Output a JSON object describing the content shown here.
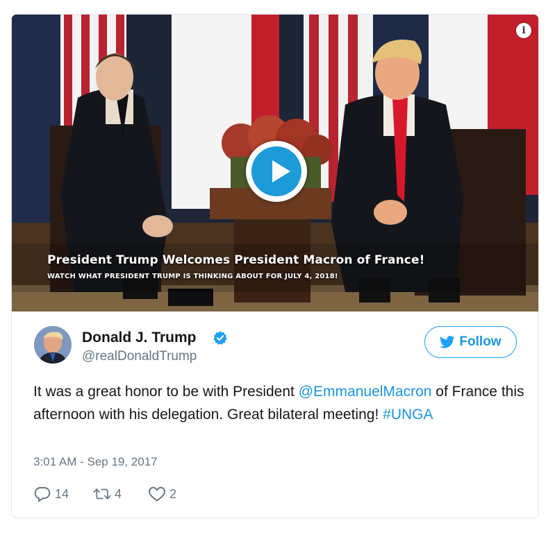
{
  "media": {
    "info_icon": "info-icon",
    "play_icon": "play-icon",
    "caption_title": "President Trump Welcomes President Macron of France!",
    "caption_subtitle": "WATCH WHAT PRESIDENT TRUMP IS THINKING ABOUT FOR JULY 4, 2018!"
  },
  "author": {
    "name": "Donald J. Trump",
    "handle": "@realDonaldTrump",
    "verified_icon": "verified-badge-icon"
  },
  "follow": {
    "label": "Follow",
    "icon": "twitter-bird-icon"
  },
  "tweet": {
    "text_1": "It was a great honor to be with President ",
    "mention": "@EmmanuelMacron",
    "text_2": " of France this afternoon with his delegation. Great bilateral meeting! ",
    "hashtag": "#UNGA"
  },
  "timestamp": "3:01 AM - Sep 19, 2017",
  "actions": {
    "reply_count": "14",
    "retweet_count": "4",
    "like_count": "2"
  },
  "colors": {
    "link": "#1b95e0",
    "play_button": "#1d9bd8",
    "text": "#14171a",
    "secondary": "#657786"
  }
}
